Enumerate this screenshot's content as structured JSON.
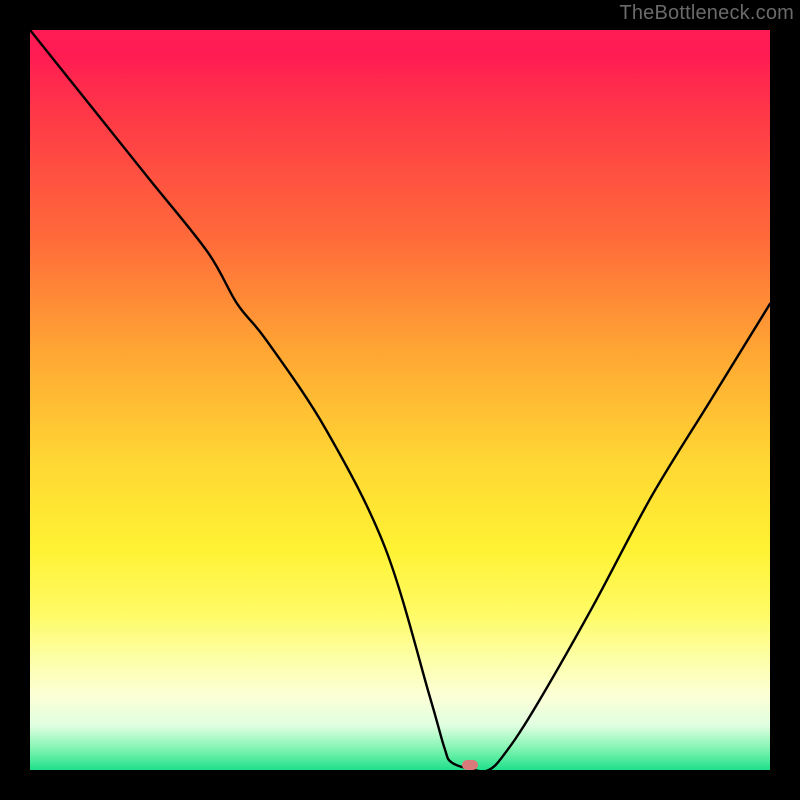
{
  "watermark": "TheBottleneck.com",
  "marker": {
    "x_frac": 0.595,
    "y_frac": 0.993
  },
  "chart_data": {
    "type": "line",
    "title": "",
    "xlabel": "",
    "ylabel": "",
    "xlim": [
      0,
      100
    ],
    "ylim": [
      0,
      100
    ],
    "series": [
      {
        "name": "curve",
        "x": [
          0,
          8,
          16,
          24,
          28,
          32,
          40,
          48,
          54,
          56,
          57,
          60,
          62,
          64,
          68,
          76,
          84,
          92,
          100
        ],
        "y": [
          100,
          90,
          80,
          70,
          63,
          58,
          46,
          30,
          10,
          3,
          1,
          0,
          0,
          2,
          8,
          22,
          37,
          50,
          63
        ]
      }
    ],
    "marker_point": {
      "x": 59.5,
      "y": 0.7
    },
    "gradient_note": "vertical red→orange→yellow→green heat gradient"
  }
}
